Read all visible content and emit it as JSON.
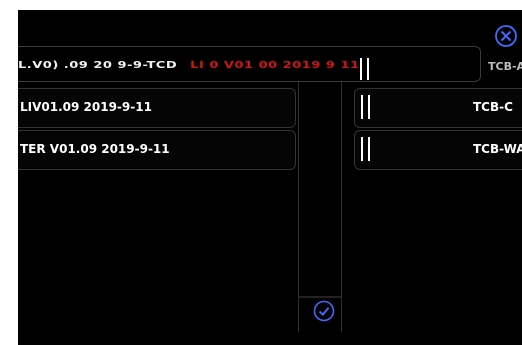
{
  "colors": {
    "accent": "#3d6cff",
    "background": "#000000",
    "glitch_red": "#d11515"
  },
  "icons": {
    "close": "close-circle-icon",
    "confirm": "check-circle-icon",
    "handle": "drag-handle-icon"
  },
  "glitch_row": {
    "text_a": "L.V0) .09 20 9-9-TCD",
    "text_b": "LI 0 V01 00 2019 9 11",
    "right_label": "TCB-A"
  },
  "left_list": [
    {
      "label": "LIV01.09 2019-9-11"
    },
    {
      "label": "TER V01.09 2019-9-11"
    }
  ],
  "right_list": [
    {
      "label": "TCB-C"
    },
    {
      "label": "TCB-WA"
    }
  ]
}
